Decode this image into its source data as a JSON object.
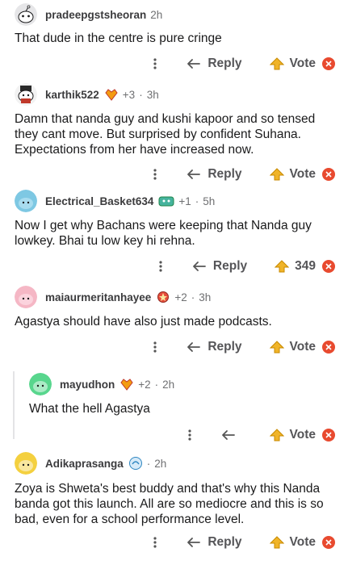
{
  "labels": {
    "reply": "Reply",
    "vote": "Vote"
  },
  "comments": [
    {
      "username": "pradeepgstsheoran",
      "flair_count": "",
      "time": "2h",
      "body": "That dude in the centre is pure cringe",
      "vote_text": "Vote",
      "show_reply": true
    },
    {
      "username": "karthik522",
      "flair_count": "+3",
      "time": "3h",
      "body": "Damn that nanda guy and kushi kapoor and so tensed\nthey cant move. But surprised by confident Suhana.\nExpectations from her have increased now.",
      "vote_text": "Vote",
      "show_reply": true
    },
    {
      "username": "Electrical_Basket634",
      "flair_count": "+1",
      "time": "5h",
      "body": "Now I get why Bachans were keeping that Nanda guy\nlowkey. Bhai tu low key hi rehna.",
      "vote_text": "349",
      "show_reply": true
    },
    {
      "username": "maiaurmeritanhayee",
      "flair_count": "+2",
      "time": "3h",
      "body": "Agastya should have also just made podcasts.",
      "vote_text": "Vote",
      "show_reply": true
    },
    {
      "username": "mayudhon",
      "flair_count": "+2",
      "time": "2h",
      "body": "What the hell Agastya",
      "vote_text": "Vote",
      "show_reply": false
    },
    {
      "username": "Adikaprasanga",
      "flair_count": "",
      "time": "2h",
      "body": "Zoya is Shweta's best buddy and that's why this Nanda\nbanda got this launch. All are so mediocre and this is so\nbad, even for a school performance level.",
      "vote_text": "Vote",
      "show_reply": true
    }
  ],
  "colors": {
    "downvote": "#e84a2f",
    "upvote_gold": "#f0b429",
    "text": "#1a1a1b",
    "muted": "#6f7072"
  }
}
